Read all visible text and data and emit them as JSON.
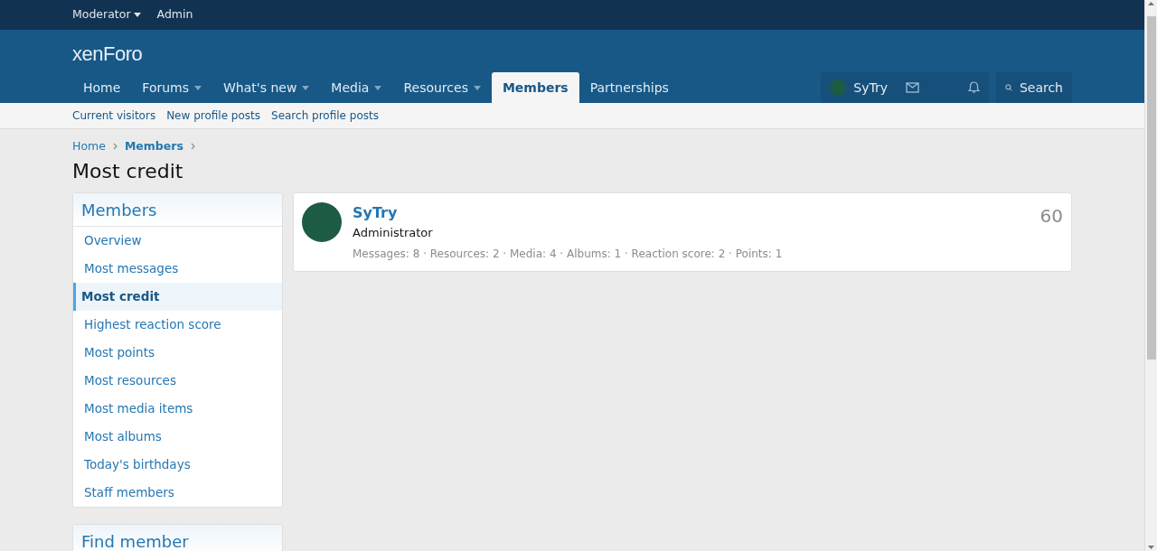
{
  "top_bar": {
    "links": [
      {
        "label": "Moderator",
        "dropdown": true
      },
      {
        "label": "Admin",
        "dropdown": false
      }
    ]
  },
  "header": {
    "logo": "xenForo",
    "nav": [
      {
        "label": "Home",
        "dropdown": false,
        "selected": false
      },
      {
        "label": "Forums",
        "dropdown": true,
        "selected": false
      },
      {
        "label": "What's new",
        "dropdown": true,
        "selected": false
      },
      {
        "label": "Media",
        "dropdown": true,
        "selected": false
      },
      {
        "label": "Resources",
        "dropdown": true,
        "selected": false
      },
      {
        "label": "Members",
        "dropdown": false,
        "selected": true
      },
      {
        "label": "Partnerships",
        "dropdown": false,
        "selected": false
      }
    ],
    "user": "SyTry",
    "search": "Search"
  },
  "sub_nav": [
    "Current visitors",
    "New profile posts",
    "Search profile posts"
  ],
  "breadcrumb": [
    {
      "label": "Home",
      "current": false
    },
    {
      "label": "Members",
      "current": true
    }
  ],
  "page_title": "Most credit",
  "sidebar": {
    "title": "Members",
    "items": [
      {
        "label": "Overview",
        "selected": false
      },
      {
        "label": "Most messages",
        "selected": false
      },
      {
        "label": "Most credit",
        "selected": true
      },
      {
        "label": "Highest reaction score",
        "selected": false
      },
      {
        "label": "Most points",
        "selected": false
      },
      {
        "label": "Most resources",
        "selected": false
      },
      {
        "label": "Most media items",
        "selected": false
      },
      {
        "label": "Most albums",
        "selected": false
      },
      {
        "label": "Today's birthdays",
        "selected": false
      },
      {
        "label": "Staff members",
        "selected": false
      }
    ],
    "find_member_title": "Find member"
  },
  "members": [
    {
      "name": "SyTry",
      "role": "Administrator",
      "stats": "Messages: 8 · Resources: 2 · Media: 4 · Albums: 1 · Reaction score: 2 · Points: 1",
      "value": "60"
    }
  ]
}
